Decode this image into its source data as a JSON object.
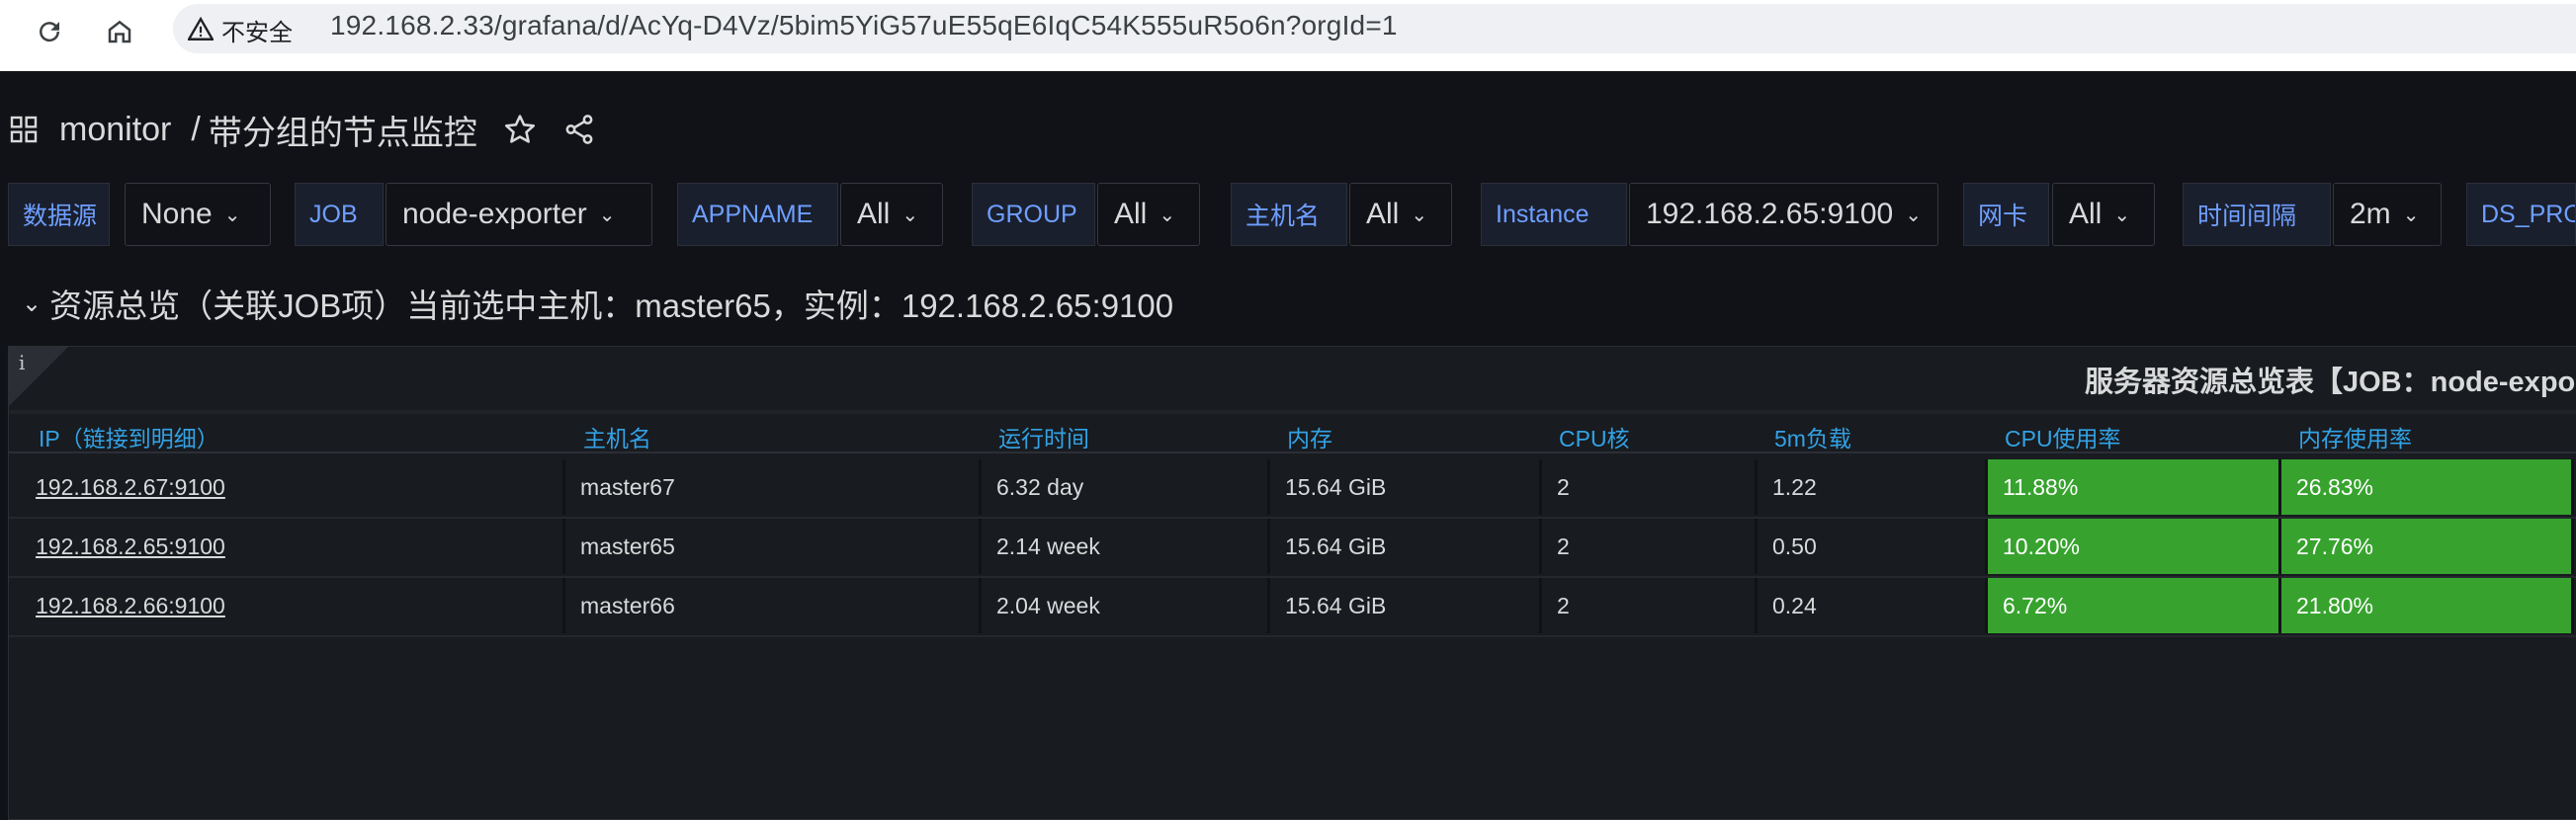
{
  "browser": {
    "security_label": "不安全",
    "url": "192.168.2.33/grafana/d/AcYq-D4Vz/5bim5YiG57uE55qE6IqC54K555uR5o6n?orgId=1"
  },
  "breadcrumb": {
    "folder": "monitor",
    "separator": "/",
    "dashboard": "带分组的节点监控"
  },
  "variables": [
    {
      "label": "数据源",
      "value": "None"
    },
    {
      "label": "JOB",
      "value": "node-exporter"
    },
    {
      "label": "APPNAME",
      "value": "All"
    },
    {
      "label": "GROUP",
      "value": "All"
    },
    {
      "label": "主机名",
      "value": "All"
    },
    {
      "label": "Instance",
      "value": "192.168.2.65:9100"
    },
    {
      "label": "网卡",
      "value": "All"
    },
    {
      "label": "时间间隔",
      "value": "2m"
    },
    {
      "label": "DS_PRO",
      "value": ""
    }
  ],
  "row_title": "资源总览（关联JOB项）当前选中主机：master65，实例：192.168.2.65:9100",
  "panel": {
    "info_icon": "i",
    "title": "服务器资源总览表【JOB：node-exporter",
    "columns": [
      "IP（链接到明细）",
      "主机名",
      "运行时间",
      "内存",
      "CPU核",
      "5m负载",
      "CPU使用率",
      "内存使用率"
    ],
    "rows": [
      [
        "192.168.2.67:9100",
        "master67",
        "6.32 day",
        "15.64 GiB",
        "2",
        "1.22",
        "11.88%",
        "26.83%"
      ],
      [
        "192.168.2.65:9100",
        "master65",
        "2.14 week",
        "15.64 GiB",
        "2",
        "0.50",
        "10.20%",
        "27.76%"
      ],
      [
        "192.168.2.66:9100",
        "master66",
        "2.04 week",
        "15.64 GiB",
        "2",
        "0.24",
        "6.72%",
        "21.80%"
      ]
    ]
  },
  "colors": {
    "accent_label": "#6e9fff",
    "header_text": "#33a2e5",
    "ok_green": "#37a32e",
    "background": "#111217"
  },
  "icons": [
    "reload-icon",
    "home-icon",
    "warning-icon",
    "apps-grid-icon",
    "star-icon",
    "share-icon",
    "chevron-down-icon",
    "info-icon"
  ]
}
